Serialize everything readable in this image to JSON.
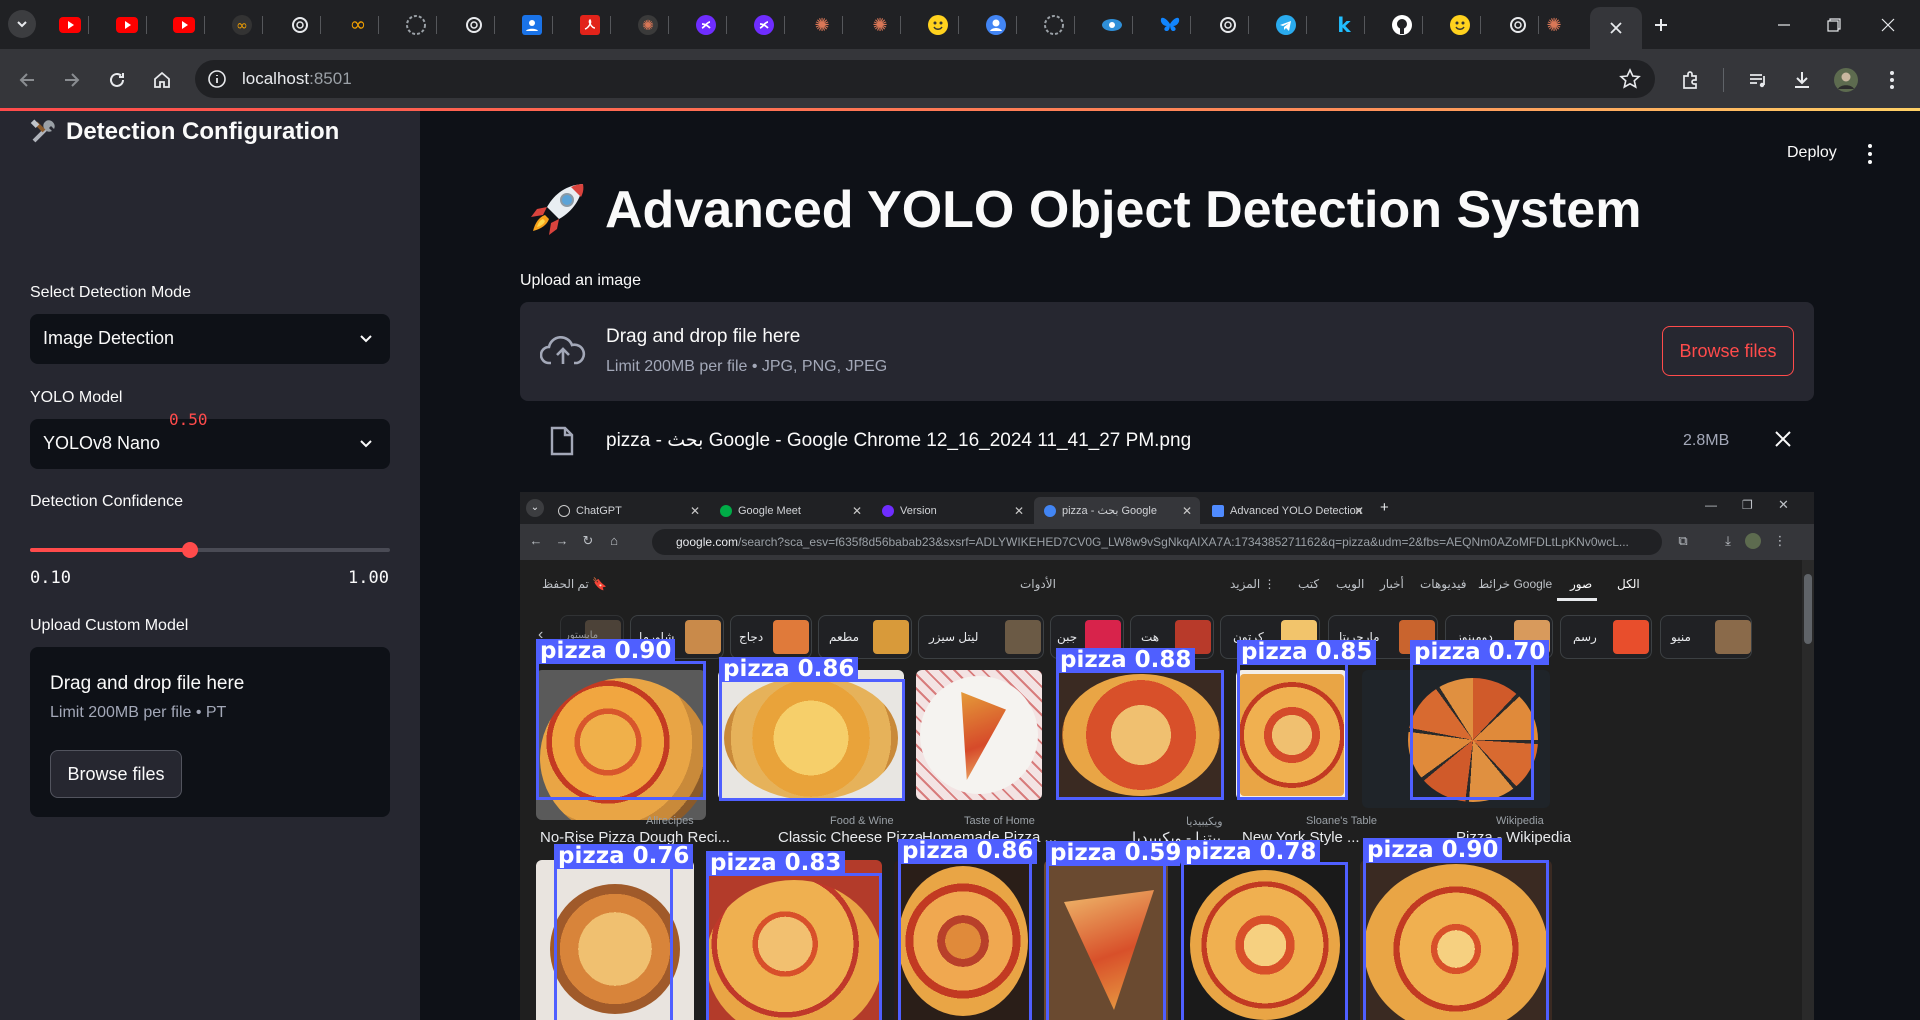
{
  "browser": {
    "url_host": "localhost",
    "url_port": ":8501"
  },
  "sidebar": {
    "title": "Detection Configuration",
    "mode_label": "Select Detection Mode",
    "mode_value": "Image Detection",
    "model_label": "YOLO Model",
    "model_value": "YOLOv8 Nano",
    "confidence_label": "Detection Confidence",
    "confidence_value": "0.50",
    "confidence_fraction": 0.4444,
    "confidence_min": "0.10",
    "confidence_max": "1.00",
    "custom_model_label": "Upload Custom Model",
    "custom_drop_title": "Drag and drop file here",
    "custom_drop_limit": "Limit 200MB per file • PT",
    "custom_browse": "Browse files"
  },
  "header": {
    "deploy": "Deploy"
  },
  "main": {
    "title": "Advanced YOLO Object Detection System",
    "upload_label": "Upload an image",
    "drop_title": "Drag and drop file here",
    "drop_limit": "Limit 200MB per file • JPG, PNG, JPEG",
    "browse": "Browse files",
    "file_name": "pizza - بحث Google - Google Chrome 12_16_2024 11_41_27 PM.png",
    "file_size": "2.8MB"
  },
  "screenshot": {
    "tabs": [
      "ChatGPT",
      "Google Meet",
      "Version",
      "pizza - بحث Google",
      "Advanced YOLO Detection"
    ],
    "url_main": "google.com",
    "url_rest": "/search?sca_esv=f635f8d56babab23&sxsrf=ADLYWIKEHED7CV0G_LW8w9vSgNkqAIXA7A:1734385271162&q=pizza&udm=2&fbs=AEQNm0AZoMFDLtLpKNv0wcL...",
    "saved": "تم الحفظ",
    "tools": "الأدوات",
    "menu": [
      "الكل",
      "صور",
      "خرائط Google",
      "فيديوهات",
      "أخبار",
      "الويب",
      "كتب",
      "المزيد ⋮"
    ],
    "chips": [
      "منيو",
      "رسم",
      "دومينوز",
      "مارجريتا",
      "كرتون",
      "هت",
      "جبن",
      "ليتل سيزر",
      "مطعم",
      "دجاج",
      "شاورما",
      "مابستور"
    ],
    "results": [
      {
        "label": "pizza 0.90",
        "source": "Allrecipes",
        "caption": "No-Rise Pizza Dough Reci..."
      },
      {
        "label": "pizza 0.86",
        "source": "Food & Wine",
        "caption": "Classic Cheese Pizza"
      },
      {
        "label": "",
        "source": "Taste of Home",
        "caption": "Homemade Pizza ..."
      },
      {
        "label": "pizza 0.88",
        "source": "ويكيبيديا",
        "caption": "بيتزا - ويكيبيديا"
      },
      {
        "label": "pizza 0.85",
        "source": "Sloane's Table",
        "caption": "New York Style ..."
      },
      {
        "label": "pizza 0.70",
        "source": "Wikipedia",
        "caption": "Pizza - Wikipedia"
      }
    ],
    "row2_labels": [
      "pizza 0.76",
      "pizza 0.83",
      "pizza 0.86",
      "pizza 0.59",
      "pizza 0.78",
      "pizza 0.90"
    ]
  }
}
